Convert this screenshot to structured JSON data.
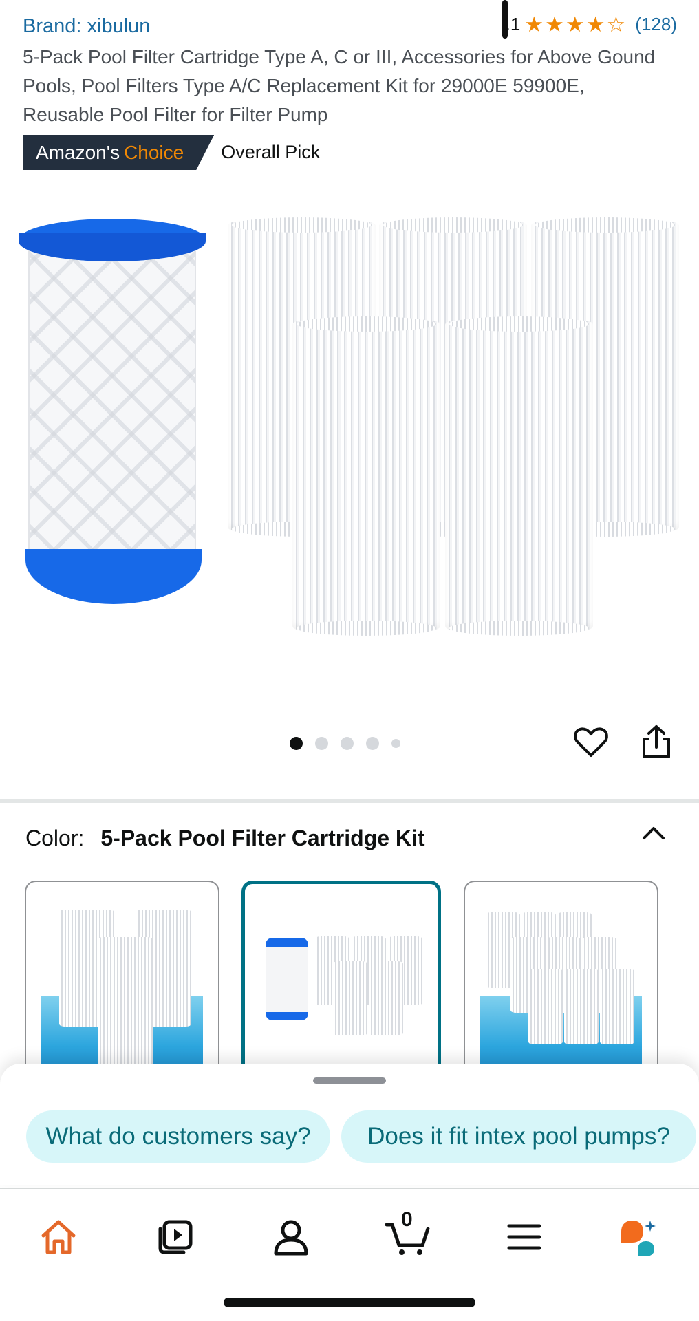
{
  "header": {
    "brand": "Brand: xibulun",
    "rating_value": ".1",
    "rating_stars": 4.5,
    "review_count": "(128)",
    "title": "5-Pack Pool Filter Cartridge Type A, C or III, Accessories for Above Gound Pools, Pool Filters Type A/C Replacement Kit for 29000E 59900E, Reusable Pool Filter for Filter Pump"
  },
  "badge": {
    "prefix": "Amazon's",
    "accent": "Choice",
    "pick": "Overall Pick"
  },
  "gallery": {
    "total_images": 5,
    "current_index": 1
  },
  "color_selector": {
    "label": "Color:",
    "value": "5-Pack Pool Filter Cartridge Kit",
    "selected_index": 2,
    "swatch_count": 3
  },
  "sheet": {
    "suggestions": [
      "What do customers say?",
      "Does it fit intex pool pumps?"
    ]
  },
  "tabbar": {
    "items": [
      "home-icon",
      "video-icon",
      "account-icon",
      "cart-icon",
      "menu-icon",
      "rufus-icon"
    ],
    "cart_count": "0"
  },
  "colors": {
    "brand_link": "#1a6aa0",
    "star": "#f08804",
    "badge_bg": "#232f3e",
    "selected_border": "#007185",
    "chip_bg": "#d7f6f9",
    "chip_text": "#0a6b78",
    "home_active": "#e4682a"
  }
}
